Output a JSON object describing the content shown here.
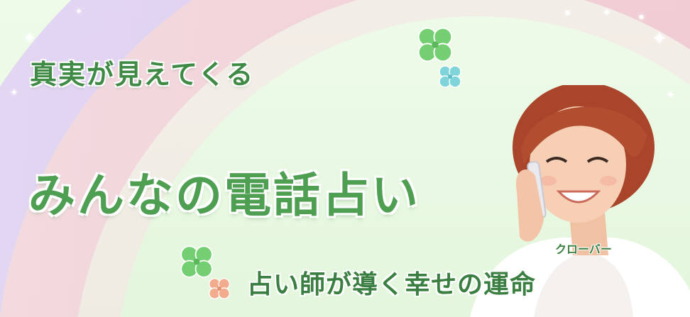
{
  "banner": {
    "headline": "真実が見えてくる",
    "title": "みんなの電話占い",
    "tagline": "占い師が導く幸せの運命",
    "ruby": "クローバー"
  },
  "icons": {
    "clover": "four-leaf-clover-icon",
    "sparkle": "sparkle-icon"
  },
  "colors": {
    "text_green": "#3f8a45",
    "title_green": "#4e9f52",
    "background": "#e8f8e2",
    "rainbow_purple": "#dcc4f2",
    "rainbow_pink": "#f3c6d2",
    "clover_green": "#6fcf6f",
    "clover_teal": "#7fd3d8",
    "clover_orange": "#f0a886"
  }
}
